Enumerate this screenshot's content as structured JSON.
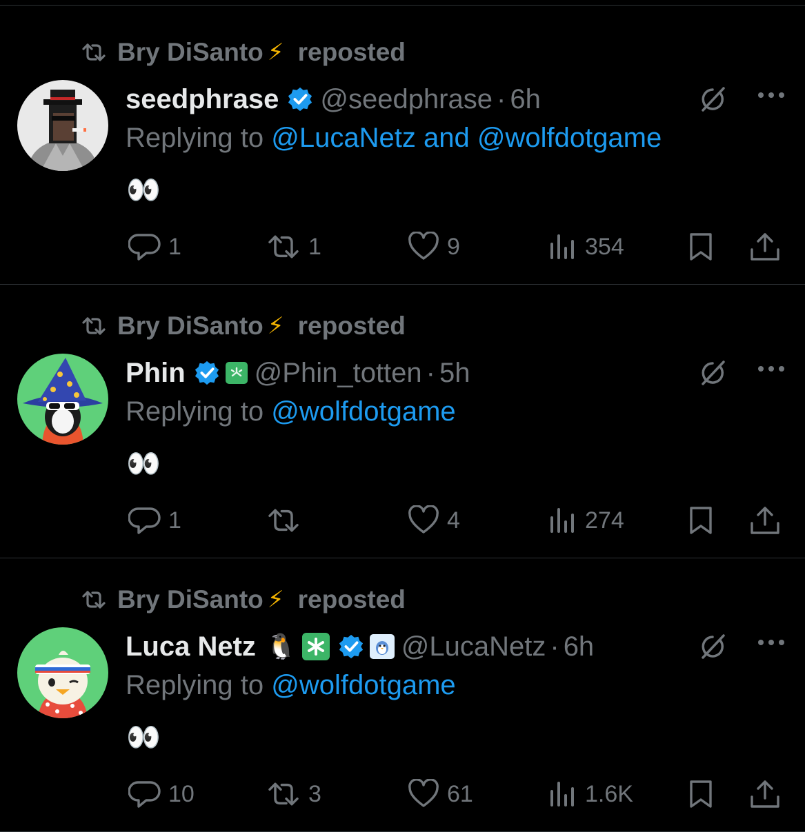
{
  "repost": {
    "name": "Bry DiSanto",
    "emoji": "⚡",
    "label": "reposted"
  },
  "tweets": [
    {
      "name": "seedphrase",
      "handle": "@seedphrase",
      "sep": "·",
      "time": "6h",
      "replying_prefix": "Replying to",
      "mentions": [
        "@LucaNetz",
        "@wolfdotgame"
      ],
      "mention_joiner": "and",
      "text": "👀",
      "stats": {
        "replies": "1",
        "reposts": "1",
        "likes": "9",
        "views": "354"
      }
    },
    {
      "name": "Phin",
      "handle": "@Phin_totten",
      "sep": "·",
      "time": "5h",
      "replying_prefix": "Replying to",
      "mentions": [
        "@wolfdotgame"
      ],
      "text": "👀",
      "stats": {
        "replies": "1",
        "reposts": "",
        "likes": "4",
        "views": "274"
      }
    },
    {
      "name": "Luca Netz",
      "name_emoji": "🐧",
      "handle": "@LucaNetz",
      "sep": "·",
      "time": "6h",
      "replying_prefix": "Replying to",
      "mentions": [
        "@wolfdotgame"
      ],
      "text": "👀",
      "stats": {
        "replies": "10",
        "reposts": "3",
        "likes": "61",
        "views": "1.6K"
      }
    }
  ],
  "colors": {
    "accent": "#1d9bf0",
    "muted": "#71767b",
    "text": "#e7e9ea",
    "bg": "#000000",
    "divider": "#2f3336"
  }
}
